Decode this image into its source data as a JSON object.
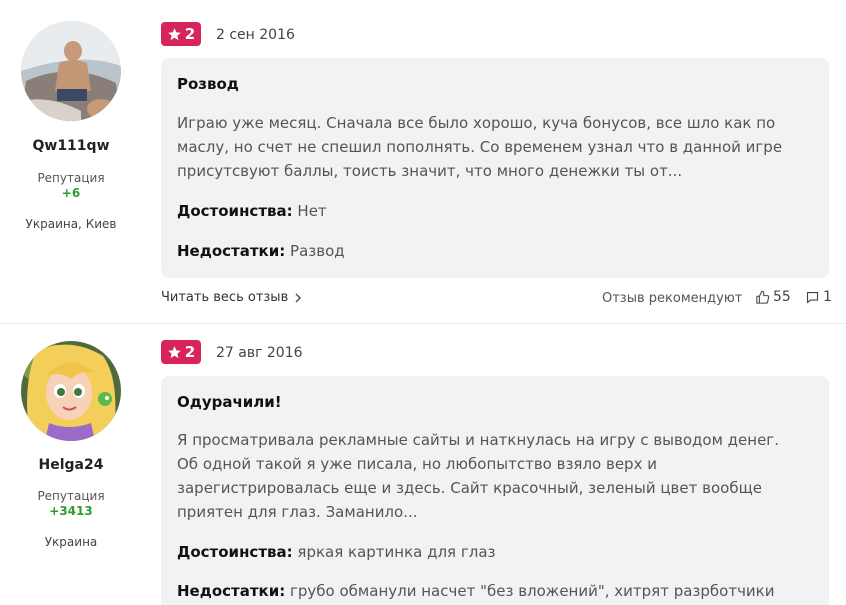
{
  "reviews": [
    {
      "user": {
        "name": "Qw111qw",
        "reputation_label": "Репутация",
        "reputation": "+6",
        "location": "Украина, Киев"
      },
      "rating": "2",
      "date": "2 сен 2016",
      "title": "Розвод",
      "text": "Играю уже месяц. Сначала все было хорошо, куча бонусов, все шло как по маслу, но счет не спешил пополнять. Со временем узнал что в данной игре присутсвуют баллы, тоисть значит, что много денежки ты от...",
      "pros_label": "Достоинства:",
      "pros": "Нет",
      "cons_label": "Недостатки:",
      "cons": "Развод",
      "read_more": "Читать весь отзыв",
      "recommend_label": "Отзыв рекомендуют",
      "likes": "55",
      "comments": "1"
    },
    {
      "user": {
        "name": "Helga24",
        "reputation_label": "Репутация",
        "reputation": "+3413",
        "location": "Украина"
      },
      "rating": "2",
      "date": "27 авг 2016",
      "title": "Одурачили!",
      "text": "Я просматривала рекламные сайты и наткнулась на игру с выводом денег. Об одной такой я уже писала, но любопытство взяло верх и зарегистрировалась еще и здесь. Сайт красочный, зеленый цвет вообще приятен для глаз. Заманило...",
      "pros_label": "Достоинства:",
      "pros": "яркая картинка для глаз",
      "cons_label": "Недостатки:",
      "cons": "грубо обманули насчет \"без вложений\", хитрят разрботчики"
    }
  ],
  "colors": {
    "badge": "#d7245a",
    "reputation": "#2e9c2e",
    "card_bg": "#f1f2f4"
  },
  "icons": {
    "star": "star-icon",
    "chevron": "chevron-right-icon",
    "like": "thumb-up-icon",
    "comment": "comment-icon"
  }
}
